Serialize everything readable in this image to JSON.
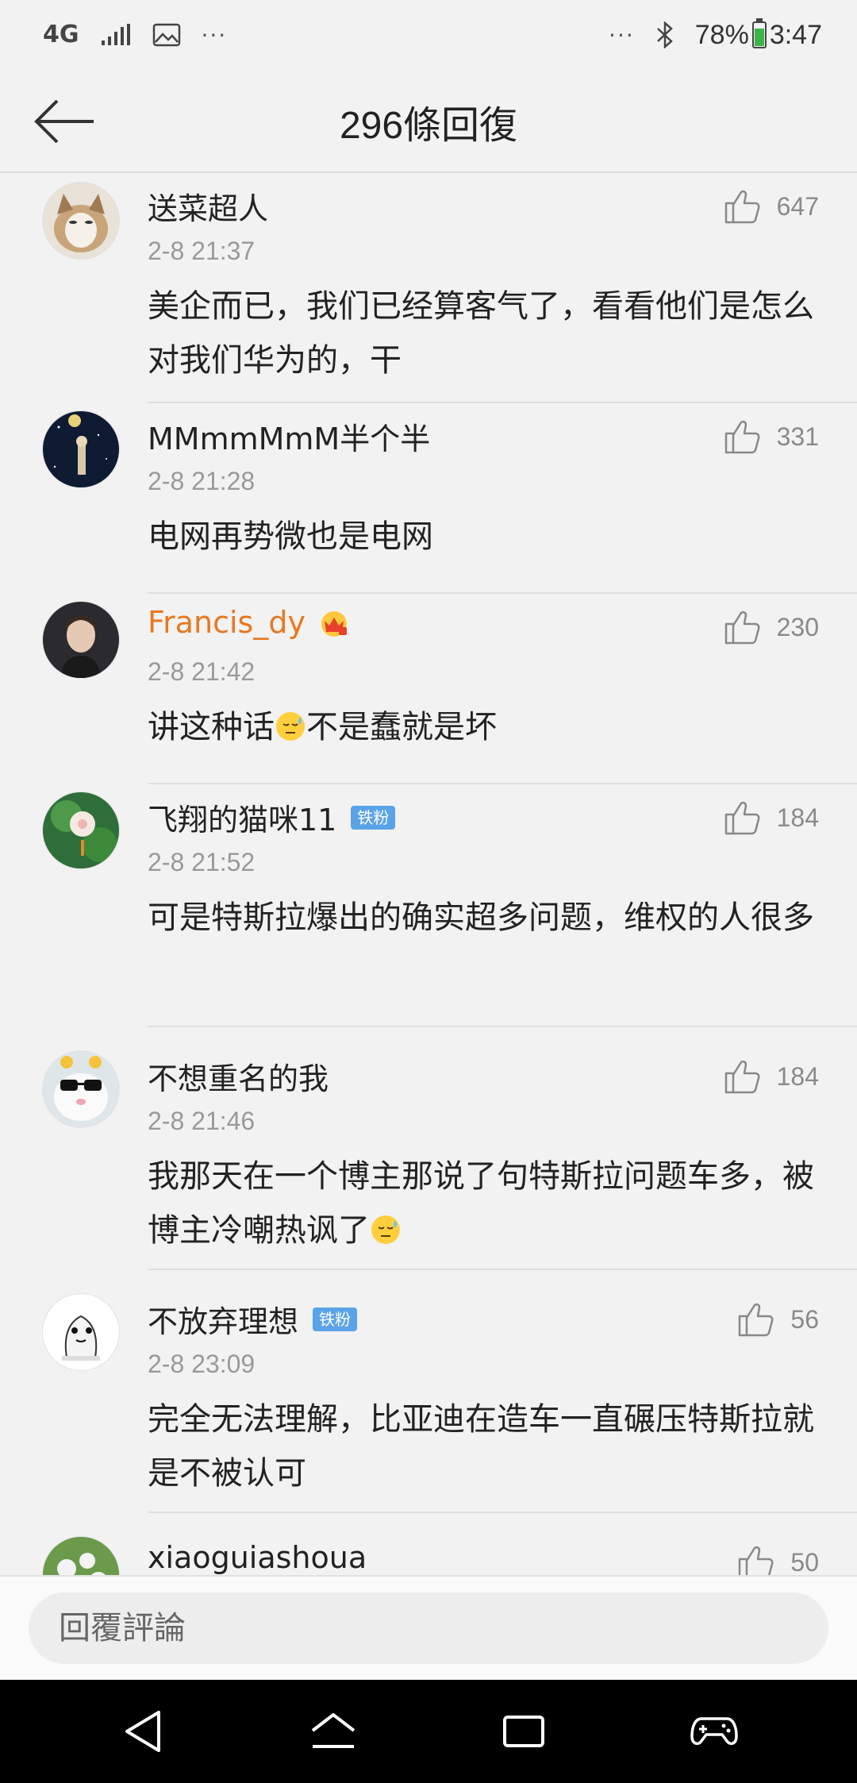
{
  "status_bar": {
    "network": "4G",
    "dots_left": "···",
    "dots_right": "···",
    "battery_percent": "78%",
    "battery_level": 0.78,
    "time": "3:47"
  },
  "header": {
    "title": "296條回復"
  },
  "comments": [
    {
      "user": "送菜超人",
      "time": "2-8 21:37",
      "likes": "647",
      "text": "美企而已，我们已经算客气了，看看他们是怎么对我们华为的，干"
    },
    {
      "user": "MMmmMmM半个半",
      "time": "2-8 21:28",
      "likes": "331",
      "text": "电网再势微也是电网"
    },
    {
      "user": "Francis_dy",
      "time": "2-8 21:42",
      "likes": "230",
      "text_a": "讲这种话",
      "text_b": "不是蠢就是坏"
    },
    {
      "user": "飞翔的猫咪11",
      "badge": "铁粉",
      "time": "2-8 21:52",
      "likes": "184",
      "text": "可是特斯拉爆出的确实超多问题，维权的人很多"
    },
    {
      "user": "不想重名的我",
      "time": "2-8 21:46",
      "likes": "184",
      "text_a": "我那天在一个博主那说了句特斯拉问题车多，被博主冷嘲热讽了",
      "text_b": ""
    },
    {
      "user": "不放弃理想",
      "badge": "铁粉",
      "time": "2-8 23:09",
      "likes": "56",
      "text": "完全无法理解，比亚迪在造车一直碾压特斯拉就是不被认可"
    },
    {
      "user": "xiaoguiashoua",
      "likes": "50"
    }
  ],
  "reply_bar": {
    "placeholder": "回覆評論"
  },
  "colors": {
    "background": "#f2f2f2",
    "vip_name": "#e8771f",
    "badge": "#5aa3e8",
    "navbar": "#000000"
  }
}
